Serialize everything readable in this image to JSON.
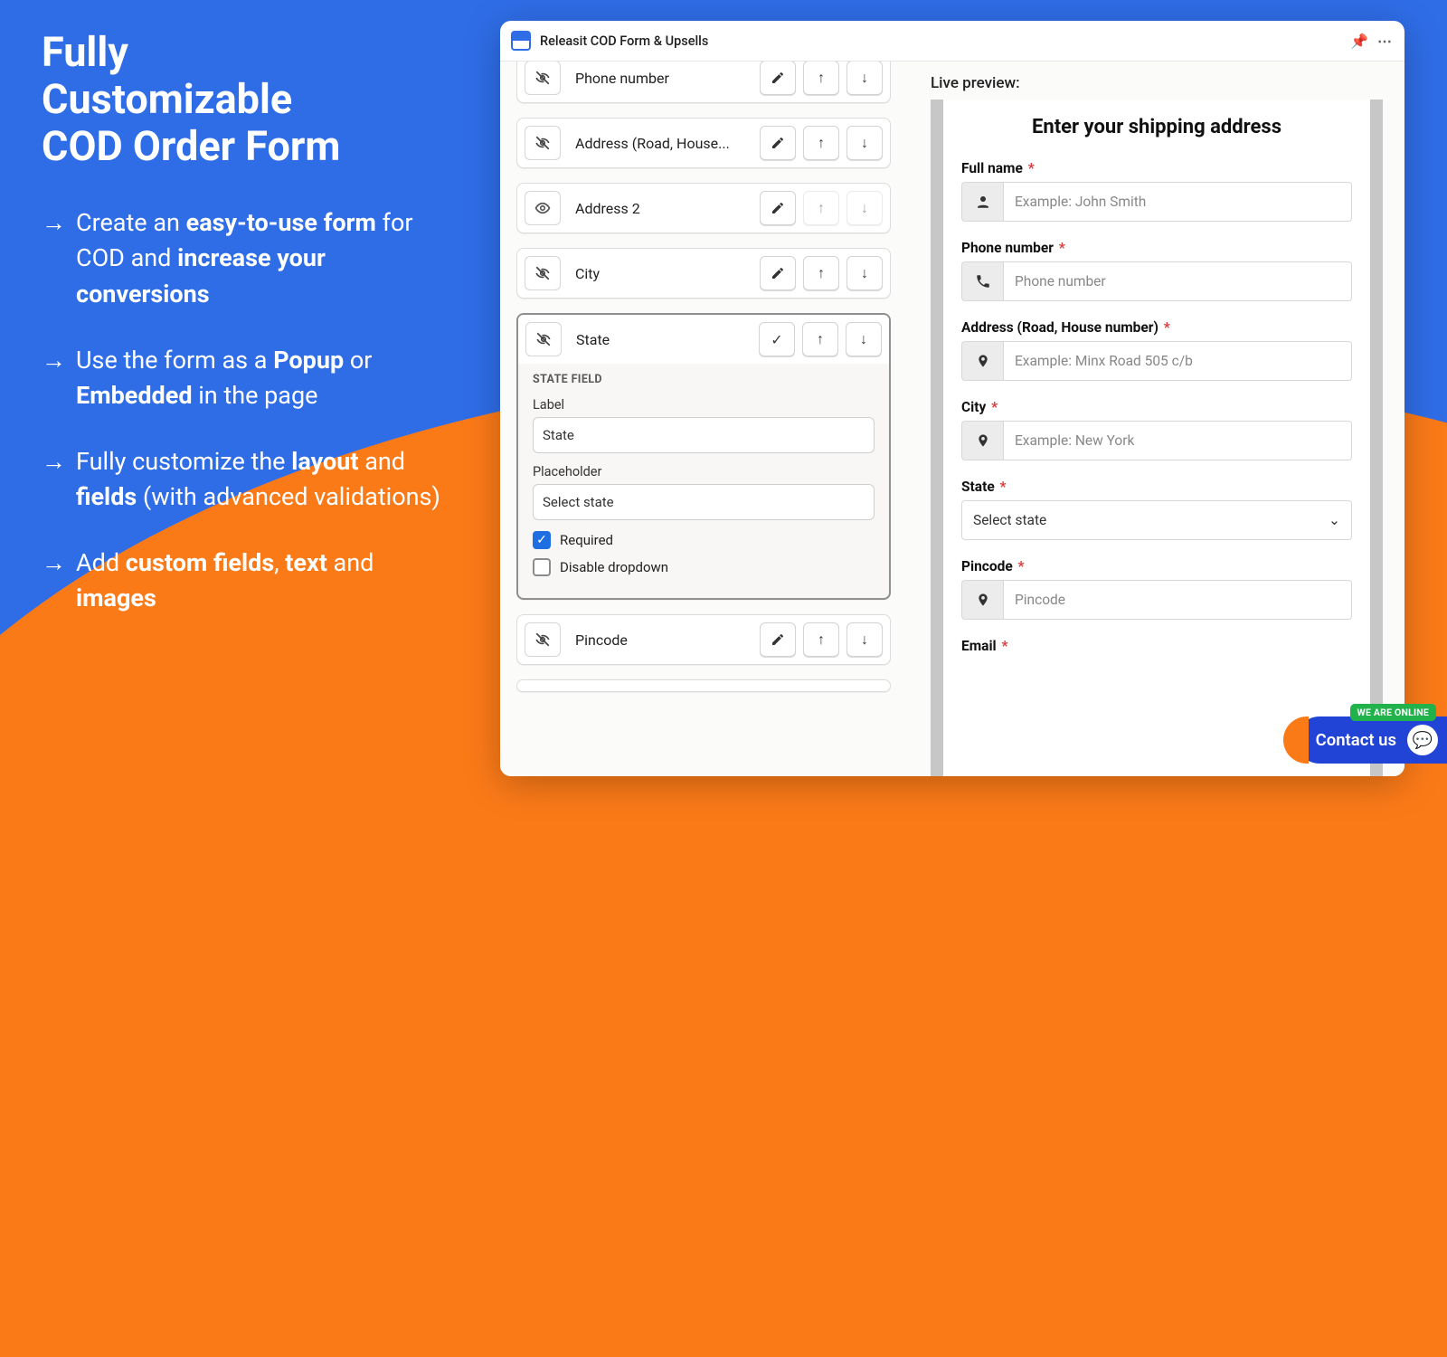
{
  "marketing": {
    "headline_l1": "Fully",
    "headline_l2": "Customizable",
    "headline_l3": "COD Order Form",
    "bullet1_pre": "Create an ",
    "bullet1_b1": "easy-to-use form",
    "bullet1_mid": " for COD and ",
    "bullet1_b2": "increase your conversions",
    "bullet2_pre": "Use the form as a ",
    "bullet2_b1": "Popup",
    "bullet2_mid": " or ",
    "bullet2_b2": "Embedded",
    "bullet2_post": " in the page",
    "bullet3_pre": "Fully customize the ",
    "bullet3_b1": "layout",
    "bullet3_mid": " and ",
    "bullet3_b2": "fields",
    "bullet3_post": " (with advanced validations)",
    "bullet4_pre": "Add ",
    "bullet4_b1": "custom fields",
    "bullet4_mid": ", ",
    "bullet4_b2": "text",
    "bullet4_mid2": " and ",
    "bullet4_b3": "images"
  },
  "window": {
    "title": "Releasit COD Form & Upsells"
  },
  "builder": {
    "fields": {
      "phone": "Phone number",
      "address": "Address (Road, House...",
      "address2": "Address 2",
      "city": "City",
      "state": "State",
      "pincode": "Pincode"
    },
    "stateEditor": {
      "sectionTitle": "STATE FIELD",
      "labelLabel": "Label",
      "labelValue": "State",
      "placeholderLabel": "Placeholder",
      "placeholderValue": "Select state",
      "requiredLabel": "Required",
      "disableDropdownLabel": "Disable dropdown"
    }
  },
  "preview": {
    "heading": "Live preview:",
    "formTitle": "Enter your shipping address",
    "fullName": {
      "label": "Full name",
      "placeholder": "Example: John Smith"
    },
    "phone": {
      "label": "Phone number",
      "placeholder": "Phone number"
    },
    "address": {
      "label": "Address (Road, House number)",
      "placeholder": "Example: Minx Road 505 c/b"
    },
    "city": {
      "label": "City",
      "placeholder": "Example: New York"
    },
    "state": {
      "label": "State",
      "placeholder": "Select state"
    },
    "pincode": {
      "label": "Pincode",
      "placeholder": "Pincode"
    },
    "email": {
      "label": "Email"
    }
  },
  "contact": {
    "label": "Contact us",
    "badge": "WE ARE ONLINE"
  }
}
